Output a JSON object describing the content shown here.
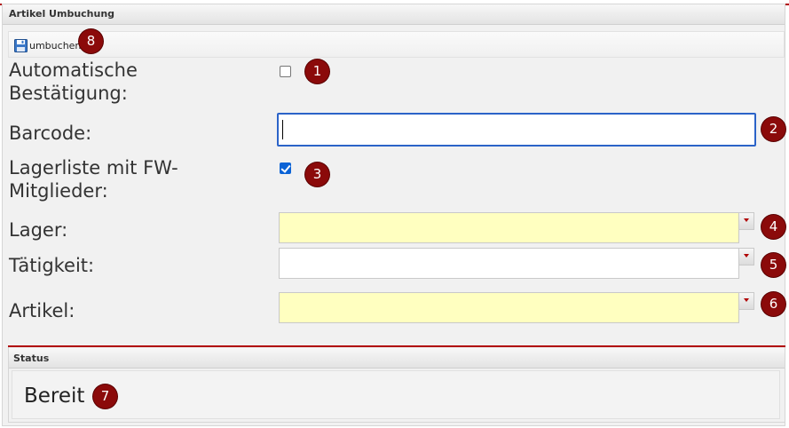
{
  "panel": {
    "title": "Artikel Umbuchung"
  },
  "toolbar": {
    "book_label": "umbuchen",
    "book_icon": "save-disk-icon"
  },
  "form": {
    "auto_confirm": {
      "label": "Automatische Bestätigung:",
      "checked": false
    },
    "barcode": {
      "label": "Barcode:",
      "value": ""
    },
    "storage_list_fw": {
      "label": "Lagerliste mit FW-Mitglieder:",
      "checked": true
    },
    "storage": {
      "label": "Lager:",
      "value": ""
    },
    "activity": {
      "label": "Tätigkeit:",
      "value": ""
    },
    "article": {
      "label": "Artikel:",
      "value": ""
    }
  },
  "status": {
    "title": "Status",
    "text": "Bereit"
  },
  "badges": [
    "1",
    "2",
    "3",
    "4",
    "5",
    "6",
    "7",
    "8"
  ],
  "colors": {
    "accent": "#b00000",
    "badge": "#8b0a0a",
    "required_field": "#ffffc0",
    "focus_border": "#2b63c8",
    "checkbox_checked": "#0b63d6"
  }
}
